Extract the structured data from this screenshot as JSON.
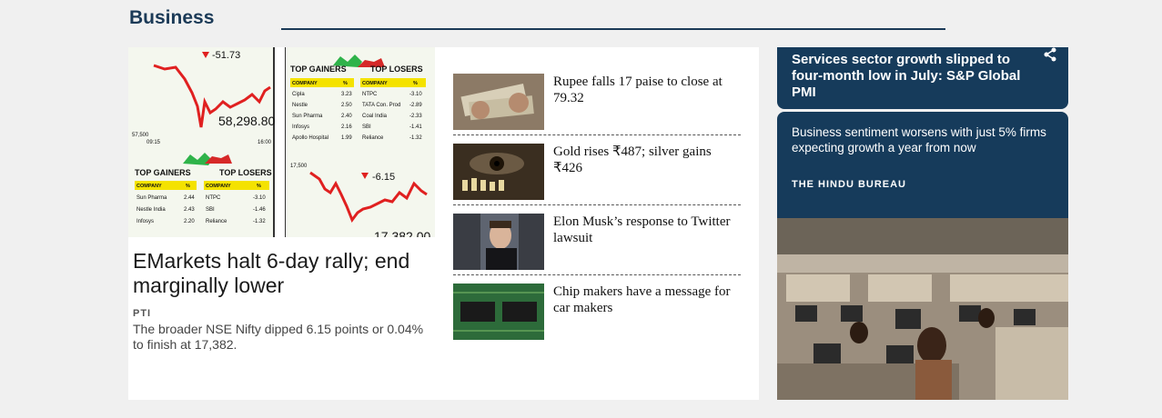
{
  "section": {
    "title": "Business"
  },
  "lead": {
    "headline": "EMarkets halt 6-day rally; end marginally lower",
    "byline": "PTI",
    "summary": "The broader NSE Nifty dipped 6.15 points or 0.04% to finish at 17,382.",
    "graphic": {
      "sensex_change": "-51.73",
      "sensex_close": "58,298.80",
      "sensex_open_label": "57,500",
      "time_start": "09:15",
      "time_end": "16:00",
      "nifty_change": "-6.15",
      "nifty_close": "17,382.00",
      "nifty_axis_label": "17,500",
      "gainers_title": "TOP GAINERS",
      "losers_title": "TOP LOSERS",
      "col_company": "COMPANY",
      "col_pct": "%",
      "sensex_gainers": [
        [
          "Sun Pharma",
          "2.44"
        ],
        [
          "Nestle India",
          "2.43"
        ],
        [
          "Infosys",
          "2.20"
        ]
      ],
      "sensex_losers": [
        [
          "NTPC",
          "-3.10"
        ],
        [
          "SBI",
          "-1.46"
        ],
        [
          "Reliance",
          "-1.32"
        ]
      ],
      "nifty_gainers": [
        [
          "Cipla",
          "3.23"
        ],
        [
          "Nestle",
          "2.50"
        ],
        [
          "Sun Pharma",
          "2.40"
        ],
        [
          "Infosys",
          "2.16"
        ],
        [
          "Apollo Hospital",
          "1.99"
        ]
      ],
      "nifty_losers": [
        [
          "NTPC",
          "-3.10"
        ],
        [
          "TATA Con. Prod",
          "-2.89"
        ],
        [
          "Coal India",
          "-2.33"
        ],
        [
          "SBI",
          "-1.41"
        ],
        [
          "Reliance",
          "-1.32"
        ]
      ]
    }
  },
  "stories": [
    {
      "title": "Rupee falls 17 paise to close at 79.32",
      "thumb": "currency-notes-image"
    },
    {
      "title": "Gold rises ₹487; silver gains ₹426",
      "thumb": "eye-chess-image"
    },
    {
      "title": "Elon Musk’s response to Twitter lawsuit",
      "thumb": "elon-musk-image"
    },
    {
      "title": "Chip makers have a message for car makers",
      "thumb": "circuit-board-image"
    }
  ],
  "sidebar": {
    "top_card_title": "Services sector growth slipped to four-month low in July: S&P Global PMI",
    "mid_card_title": "Business sentiment worsens with just 5% firms expecting growth a year from now",
    "mid_card_author": "THE HINDU BUREAU"
  },
  "colors": {
    "brand_dark": "#163b5b",
    "chart_line": "#e02020",
    "gainer_green": "#2fb34a",
    "loser_red": "#d62828"
  }
}
